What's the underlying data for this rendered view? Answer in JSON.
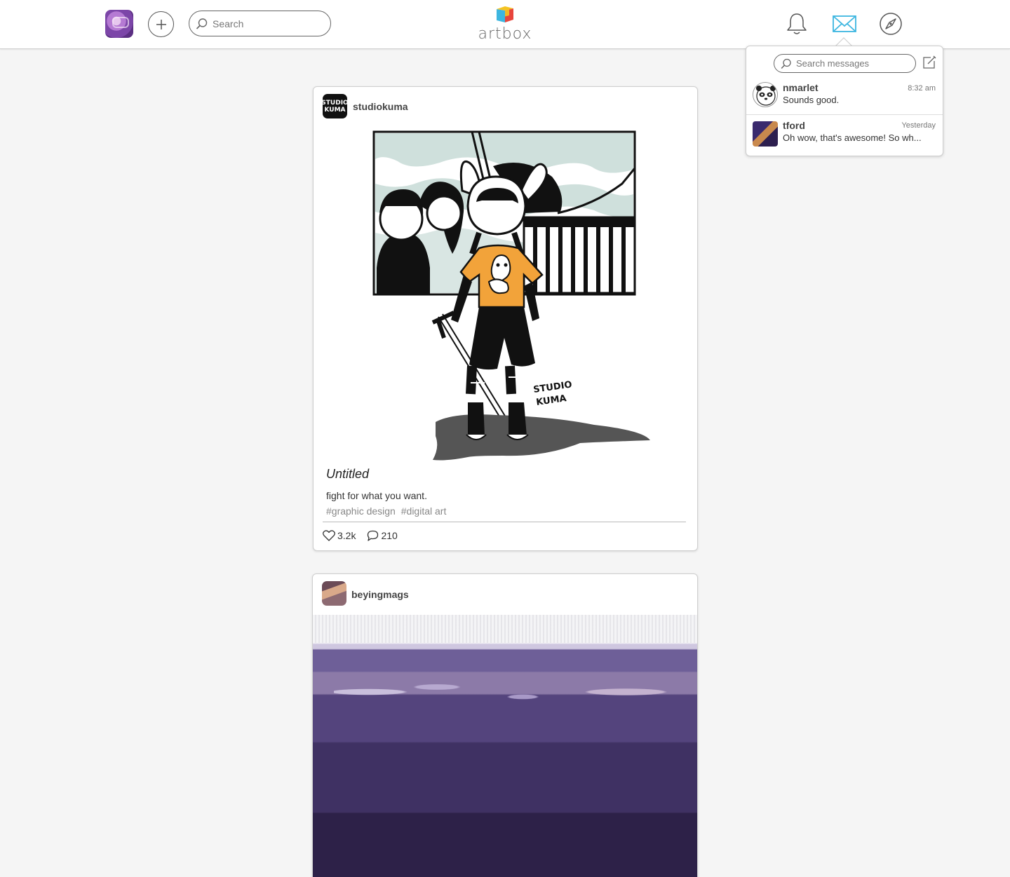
{
  "header": {
    "search_placeholder": "Search",
    "logo_text": "artbox"
  },
  "messages": {
    "search_placeholder": "Search messages",
    "items": [
      {
        "name": "nmarlet",
        "time": "8:32 am",
        "preview": "Sounds good."
      },
      {
        "name": "tford",
        "time": "Yesterday",
        "preview": "Oh wow, that's awesome! So wh..."
      }
    ]
  },
  "posts": [
    {
      "user": "studiokuma",
      "avatar_text": "STUDIO KUMA",
      "title": "Untitled",
      "description": "fight for what you want.",
      "tags": [
        "#graphic design",
        "#digital art"
      ],
      "likes": "3.2k",
      "comments": "210"
    },
    {
      "user": "beyingmags"
    }
  ],
  "colors": {
    "accent": "#3db6e0",
    "background": "#f5f5f5",
    "artwork_orange": "#f2a33a",
    "artwork_sky": "#cfe0dc"
  }
}
